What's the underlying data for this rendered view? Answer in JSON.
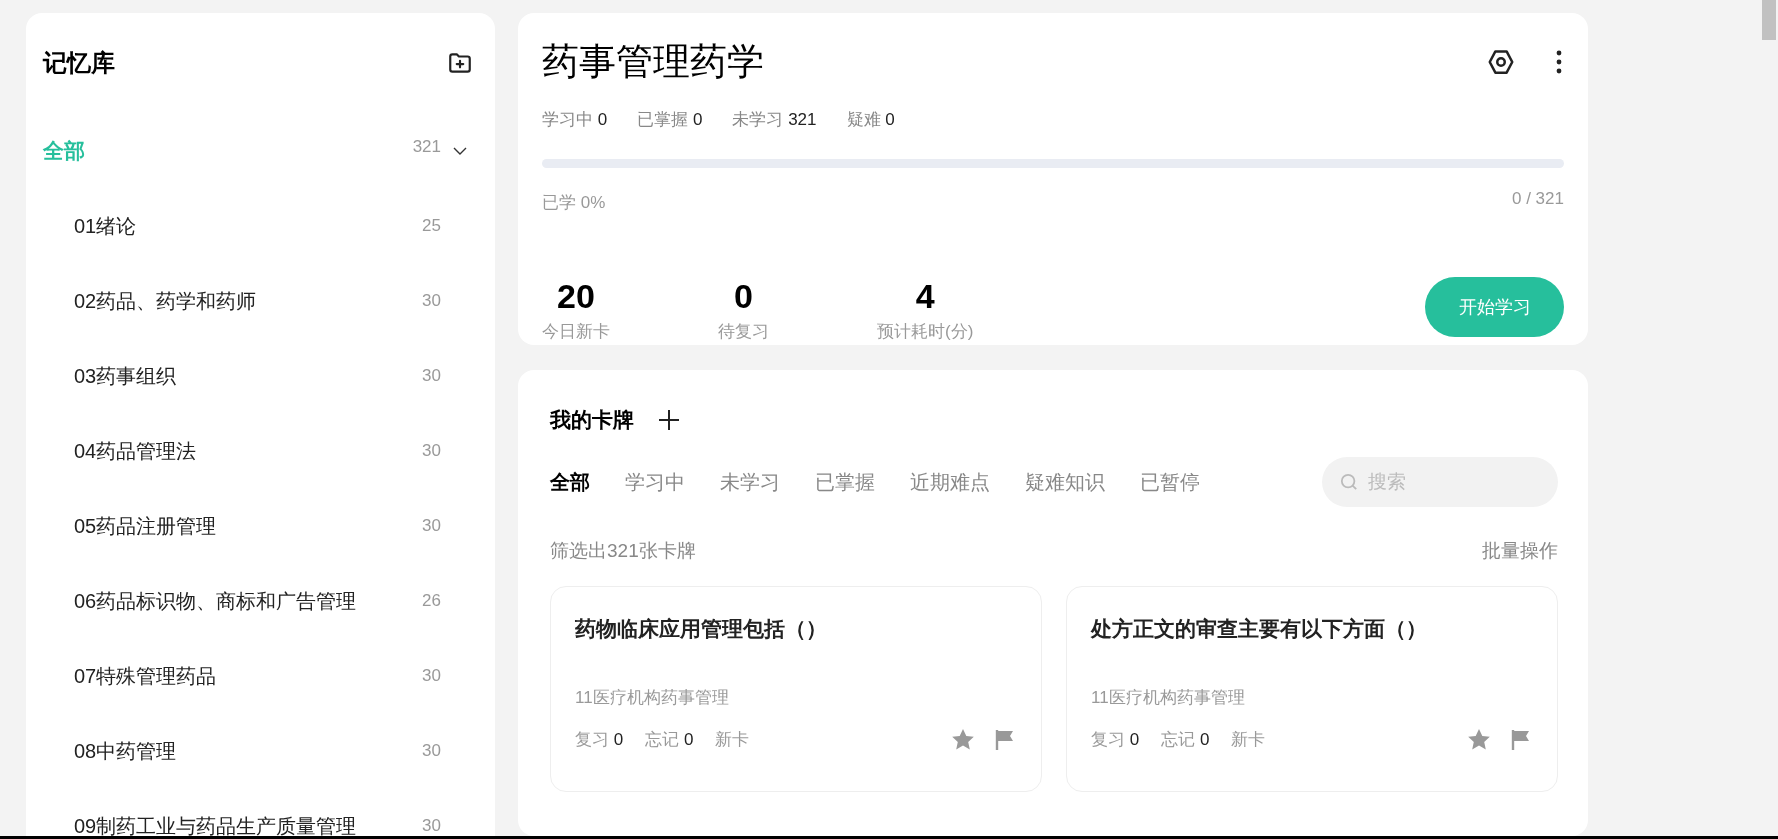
{
  "sidebar": {
    "title": "记忆库",
    "items": [
      {
        "label": "全部",
        "count": "321",
        "selected": true,
        "expanded": true,
        "children": [
          {
            "label": "01绪论",
            "count": "25",
            "selected": false
          },
          {
            "label": "02药品、药学和药师",
            "count": "30",
            "selected": false
          },
          {
            "label": "03药事组织",
            "count": "30",
            "selected": false
          },
          {
            "label": "04药品管理法",
            "count": "30",
            "selected": false
          },
          {
            "label": "05药品注册管理",
            "count": "30",
            "selected": false
          },
          {
            "label": "06药品标识物、商标和广告管理",
            "count": "26",
            "selected": false
          },
          {
            "label": "07特殊管理药品",
            "count": "30",
            "selected": false
          },
          {
            "label": "08中药管理",
            "count": "30",
            "selected": false
          },
          {
            "label": "09制药工业与药品生产质量管理",
            "count": "30",
            "selected": false
          }
        ]
      }
    ]
  },
  "deck": {
    "title": "药事管理药学",
    "stats": [
      {
        "label": "学习中",
        "value": "0"
      },
      {
        "label": "已掌握",
        "value": "0"
      },
      {
        "label": "未学习",
        "value": "321"
      },
      {
        "label": "疑难",
        "value": "0"
      }
    ],
    "progress": {
      "level": 0,
      "label": "已学 0%",
      "reading": "0 / 321"
    },
    "today": [
      {
        "value": "20",
        "label": "今日新卡"
      },
      {
        "value": "0",
        "label": "待复习"
      },
      {
        "value": "4",
        "label": "预计耗时(分)"
      }
    ],
    "start_button": "开始学习"
  },
  "cards_panel": {
    "title": "我的卡牌",
    "tabs": [
      {
        "label": "全部",
        "selected": true
      },
      {
        "label": "学习中",
        "selected": false
      },
      {
        "label": "未学习",
        "selected": false
      },
      {
        "label": "已掌握",
        "selected": false
      },
      {
        "label": "近期难点",
        "selected": false
      },
      {
        "label": "疑难知识",
        "selected": false
      },
      {
        "label": "已暂停",
        "selected": false
      }
    ],
    "search": {
      "placeholder": "搜索"
    },
    "filter_count": "筛选出321张卡牌",
    "batch_action": "批量操作",
    "cards": [
      {
        "title": "药物临床应用管理包括（）",
        "category": "11医疗机构药事管理",
        "stats": [
          {
            "label": "复习",
            "value": "0"
          },
          {
            "label": "忘记",
            "value": "0"
          }
        ],
        "tag": "新卡"
      },
      {
        "title": "处方正文的审查主要有以下方面（）",
        "category": "11医疗机构药事管理",
        "stats": [
          {
            "label": "复习",
            "value": "0"
          },
          {
            "label": "忘记",
            "value": "0"
          }
        ],
        "tag": "新卡"
      }
    ]
  }
}
